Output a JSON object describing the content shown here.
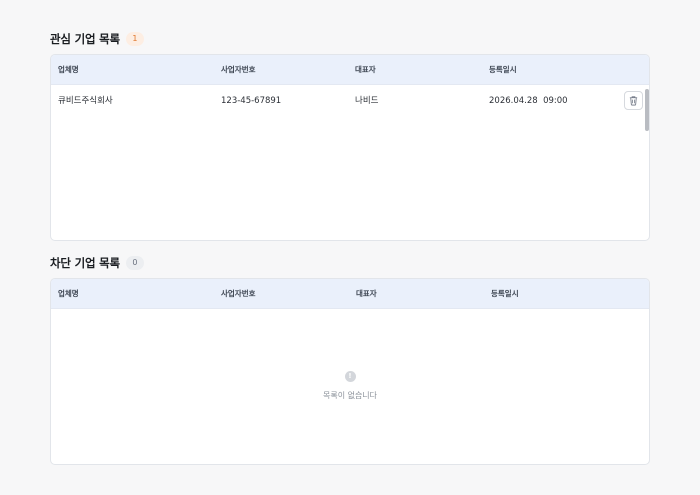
{
  "watch": {
    "title": "관심 기업 목록",
    "count": "1",
    "columns": [
      "업체명",
      "사업자번호",
      "대표자",
      "등록일시"
    ],
    "rows": [
      {
        "company": "큐비드주식회사",
        "biz_no": "123-45-67891",
        "ceo": "나비드",
        "registered": "2026.04.28  09:00",
        "action_icon": "trash-icon"
      }
    ]
  },
  "block": {
    "title": "차단 기업 목록",
    "count": "0",
    "columns": [
      "업체명",
      "사업자번호",
      "대표자",
      "등록일시"
    ],
    "empty_icon": "info-icon",
    "empty_icon_glyph": "!",
    "empty_text": "목록이 없습니다"
  },
  "colors": {
    "header_bg": "#eaf0fb",
    "warm_badge_bg": "#fdeee3",
    "warm_badge_text": "#e0782f",
    "gray_badge_bg": "#eceef1"
  }
}
